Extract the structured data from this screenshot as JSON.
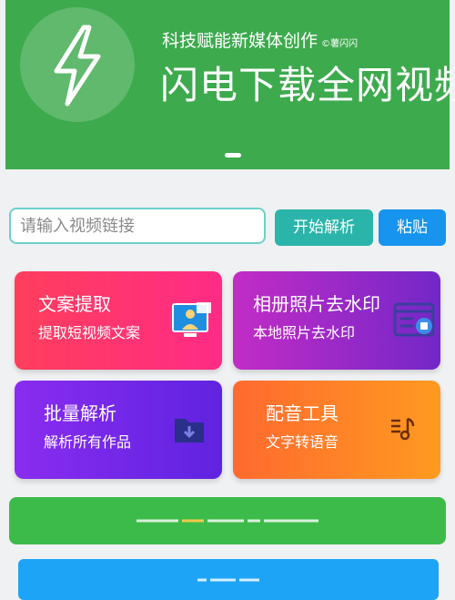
{
  "banner": {
    "subtitle": "科技赋能新媒体创作",
    "copyright": "©薯闪闪",
    "title": "闪电下载全网视频",
    "logo_icon": "lightning-bolt-icon",
    "color": "#3daa4e"
  },
  "search": {
    "placeholder": "请输入视频链接",
    "parse_label": "开始解析",
    "paste_label": "粘贴"
  },
  "features": [
    {
      "title": "文案提取",
      "subtitle": "提取短视频文案",
      "icon": "video-presenter-icon"
    },
    {
      "title": "相册照片去水印",
      "subtitle": "本地照片去水印",
      "icon": "photo-window-icon"
    },
    {
      "title": "批量解析",
      "subtitle": "解析所有作品",
      "icon": "folder-download-icon"
    },
    {
      "title": "配音工具",
      "subtitle": "文字转语音",
      "icon": "music-note-icon"
    }
  ]
}
